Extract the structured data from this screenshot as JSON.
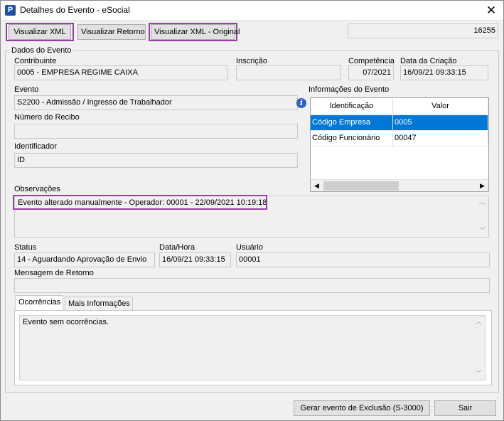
{
  "window": {
    "title": "Detalhes do Evento - eSocial",
    "app_icon": "P",
    "close": "✕"
  },
  "toolbar": {
    "view_xml": "Visualizar XML",
    "view_return": "Visualizar Retorno",
    "view_xml_original": "Visualizar XML - Original",
    "id_value": "16255"
  },
  "group": {
    "title": "Dados do Evento",
    "contribuinte": {
      "label": "Contribuinte",
      "value": "0005 - EMPRESA REGIME CAIXA"
    },
    "inscricao": {
      "label": "Inscrição",
      "value": ""
    },
    "competencia": {
      "label": "Competência",
      "value": "07/2021"
    },
    "data_criacao": {
      "label": "Data da Criação",
      "value": "16/09/21 09:33:15"
    },
    "evento": {
      "label": "Evento",
      "value": "S2200 - Admissão / Ingresso de Trabalhador"
    },
    "info_icon": "i",
    "numero_recibo": {
      "label": "Número do Recibo",
      "value": ""
    },
    "identificador": {
      "label": "Identificador",
      "value": "ID"
    },
    "info_evento": {
      "label": "Informações do Evento",
      "columns": [
        "Identificação",
        "Valor"
      ],
      "rows": [
        {
          "identificacao": "Código Empresa",
          "valor": "0005"
        },
        {
          "identificacao": "Código Funcionário",
          "valor": "00047"
        }
      ]
    },
    "observacoes": {
      "label": "Observações",
      "value": "Evento alterado manualmente - Operador: 00001 - 22/09/2021 10:19:18"
    },
    "status": {
      "label": "Status",
      "value": "14 - Aguardando Aprovação de Envio"
    },
    "data_hora": {
      "label": "Data/Hora",
      "value": "16/09/21 09:33:15"
    },
    "usuario": {
      "label": "Usuário",
      "value": "00001"
    },
    "mensagem_retorno": {
      "label": "Mensagem de Retorno",
      "value": ""
    },
    "tabs": [
      {
        "label": "Ocorrências",
        "active": true
      },
      {
        "label": "Mais Informações",
        "active": false
      }
    ],
    "ocorrencias_text": "Evento sem ocorrências."
  },
  "footer": {
    "exclusao": "Gerar evento de Exclusão (S-3000)",
    "sair": "Sair"
  },
  "colors": {
    "highlight": "#9b3fa8",
    "selection": "#0078d7",
    "info_icon": "#2a62c9"
  }
}
